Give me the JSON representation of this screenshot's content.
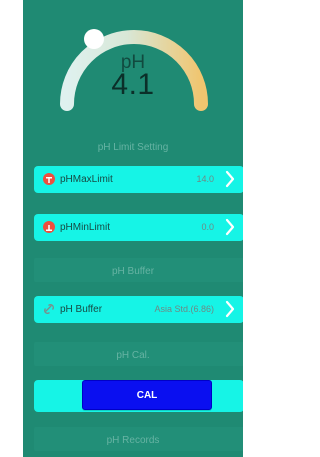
{
  "colors": {
    "background": "#1f8a73",
    "row": "#16f4e6",
    "cal_button": "#0a0ff0",
    "section_text": "#66b3a3",
    "alarm_icon": "#ef4d3e"
  },
  "gauge": {
    "unit": "pH",
    "value": "4.1",
    "knob": "white-handle"
  },
  "sections": {
    "limit": "pH Limit Setting",
    "buffer": "pH Buffer",
    "cal": "pH Cal.",
    "records": "pH Records"
  },
  "rows": {
    "max_limit": {
      "label": "pHMaxLimit",
      "value": "14.0"
    },
    "min_limit": {
      "label": "pHMinLimit",
      "value": "0.0"
    },
    "buffer": {
      "label": "pH Buffer",
      "value": "Asia Std.(6.86)"
    }
  },
  "cal": {
    "button_label": "CAL"
  },
  "icons": {
    "max_limit": "max-limit-icon",
    "min_limit": "min-limit-icon",
    "buffer": "link-icon",
    "chevron": "chevron-right-icon"
  }
}
